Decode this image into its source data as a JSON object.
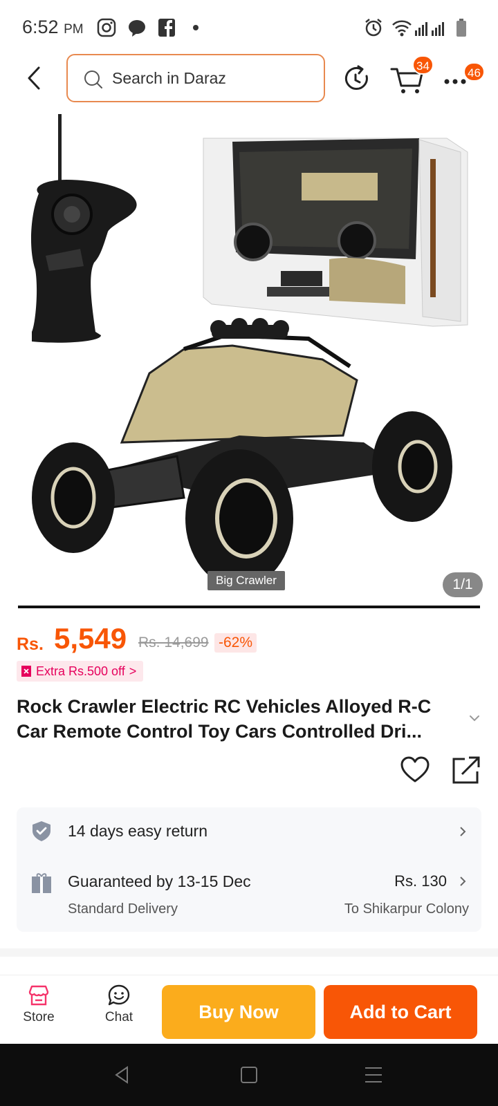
{
  "status_bar": {
    "time": "6:52",
    "ampm": "PM"
  },
  "header": {
    "search_placeholder": "Search in Daraz",
    "cart_badge": "34",
    "more_badge": "46"
  },
  "gallery": {
    "caption": "Big Crawler",
    "page_indicator": "1/1"
  },
  "price": {
    "currency": "Rs.",
    "current": "5,549",
    "original": "Rs. 14,699",
    "discount": "-62%"
  },
  "promo": {
    "extra_off": "Extra Rs.500 off",
    "chevron": ">"
  },
  "product": {
    "title": "Rock Crawler Electric RC Vehicles Alloyed R-C Car Remote Control Toy Cars Controlled Dri..."
  },
  "services": {
    "return": {
      "title": "14 days easy return"
    },
    "delivery": {
      "title": "Guaranteed by 13-15 Dec",
      "subtitle": "Standard Delivery",
      "fee": "Rs. 130",
      "location": "To Shikarpur Colony"
    }
  },
  "bottom_bar": {
    "store_label": "Store",
    "chat_label": "Chat",
    "buy_now_label": "Buy Now",
    "add_to_cart_label": "Add to Cart"
  },
  "colors": {
    "brand": "#f85606",
    "buy_now": "#fbac1c",
    "promo_pink": "#e6005c"
  }
}
